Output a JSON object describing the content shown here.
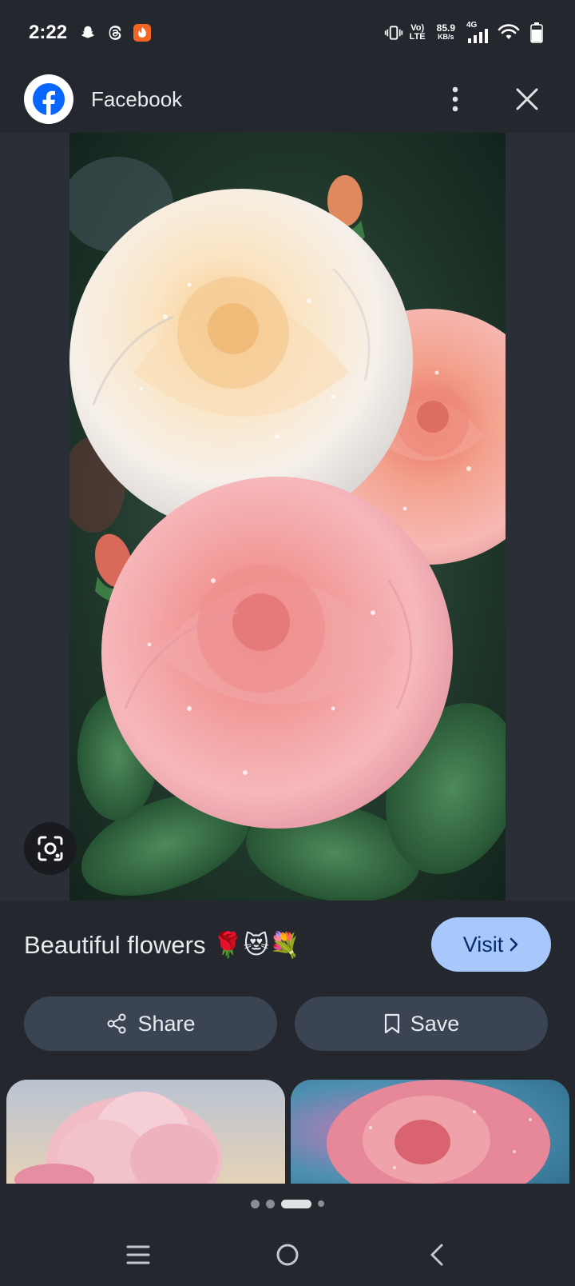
{
  "status_bar": {
    "time": "2:22",
    "volte": "Vo)",
    "lte": "LTE",
    "speed_value": "85.9",
    "speed_unit": "KB/s",
    "network": "4G"
  },
  "header": {
    "title": "Facebook"
  },
  "post": {
    "caption": "Beautiful flowers 🌹😻💐",
    "visit_label": "Visit"
  },
  "actions": {
    "share_label": "Share",
    "save_label": "Save"
  },
  "colors": {
    "background": "#24272e",
    "accent_button": "#a8c7fa",
    "action_button": "#3a4453",
    "facebook_blue": "#0866ff"
  },
  "icons": {
    "status": [
      "snapchat-icon",
      "threads-icon",
      "app-notification-icon",
      "vibrate-icon",
      "signal-icon",
      "wifi-icon",
      "battery-icon"
    ],
    "header": [
      "facebook-logo-icon",
      "more-vert-icon",
      "close-icon"
    ],
    "nav": [
      "recents-icon",
      "home-icon",
      "back-icon"
    ]
  }
}
